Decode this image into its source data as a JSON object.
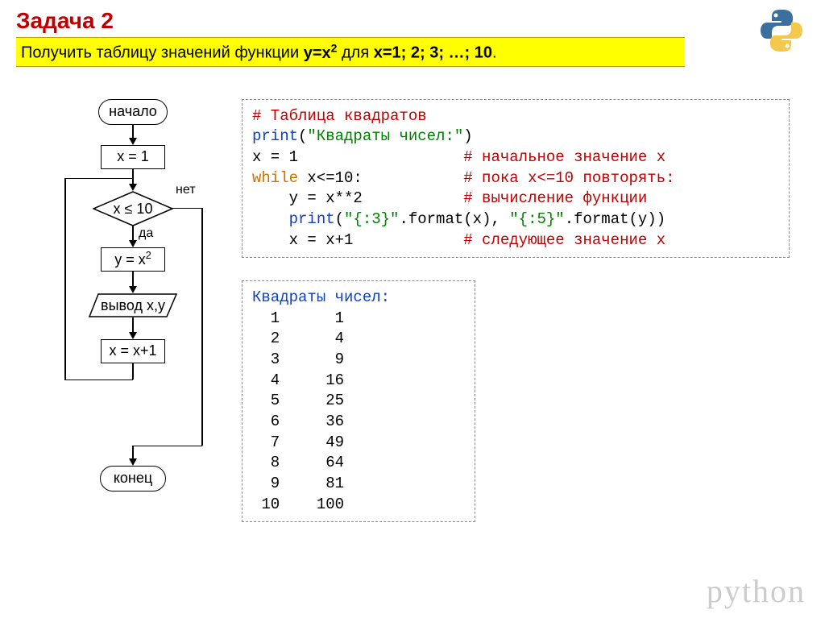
{
  "title": "Задача 2",
  "subtitle_pre": "Получить таблицу значений функции ",
  "subtitle_func": "y=x",
  "subtitle_exp": "2",
  "subtitle_post": " для ",
  "subtitle_vals": "х=1; 2; 3; …; 10",
  "subtitle_dot": ".",
  "flow": {
    "start": "начало",
    "init": "x = 1",
    "cond": "x ≤ 10",
    "yes": "да",
    "no": "нет",
    "calc_pre": "y = x",
    "calc_exp": "2",
    "out": "вывод x,y",
    "inc": "x = x+1",
    "end": "конец"
  },
  "code": {
    "l1": "# Таблица квадратов",
    "l2a": "print",
    "l2b": "(",
    "l2c": "\"Квадраты чисел:\"",
    "l2d": ")",
    "l3a": "x = 1                  ",
    "l3b": "# начальное значение x",
    "l4a": "while",
    "l4b": " x<=10:           ",
    "l4c": "# пока x<=10 повторять:",
    "l5a": "    y = x**2           ",
    "l5b": "# вычисление функции",
    "l6a": "    ",
    "l6b": "print",
    "l6c": "(",
    "l6d": "\"{:3}\"",
    "l6e": ".format(x), ",
    "l6f": "\"{:5}\"",
    "l6g": ".format(y))",
    "l7a": "    x = x+1            ",
    "l7b": "# следующее значение x"
  },
  "output_header": "Квадраты чисел:",
  "output_rows": [
    "  1      1",
    "  2      4",
    "  3      9",
    "  4     16",
    "  5     25",
    "  6     36",
    "  7     49",
    "  8     64",
    "  9     81",
    " 10    100"
  ],
  "watermark": "python"
}
